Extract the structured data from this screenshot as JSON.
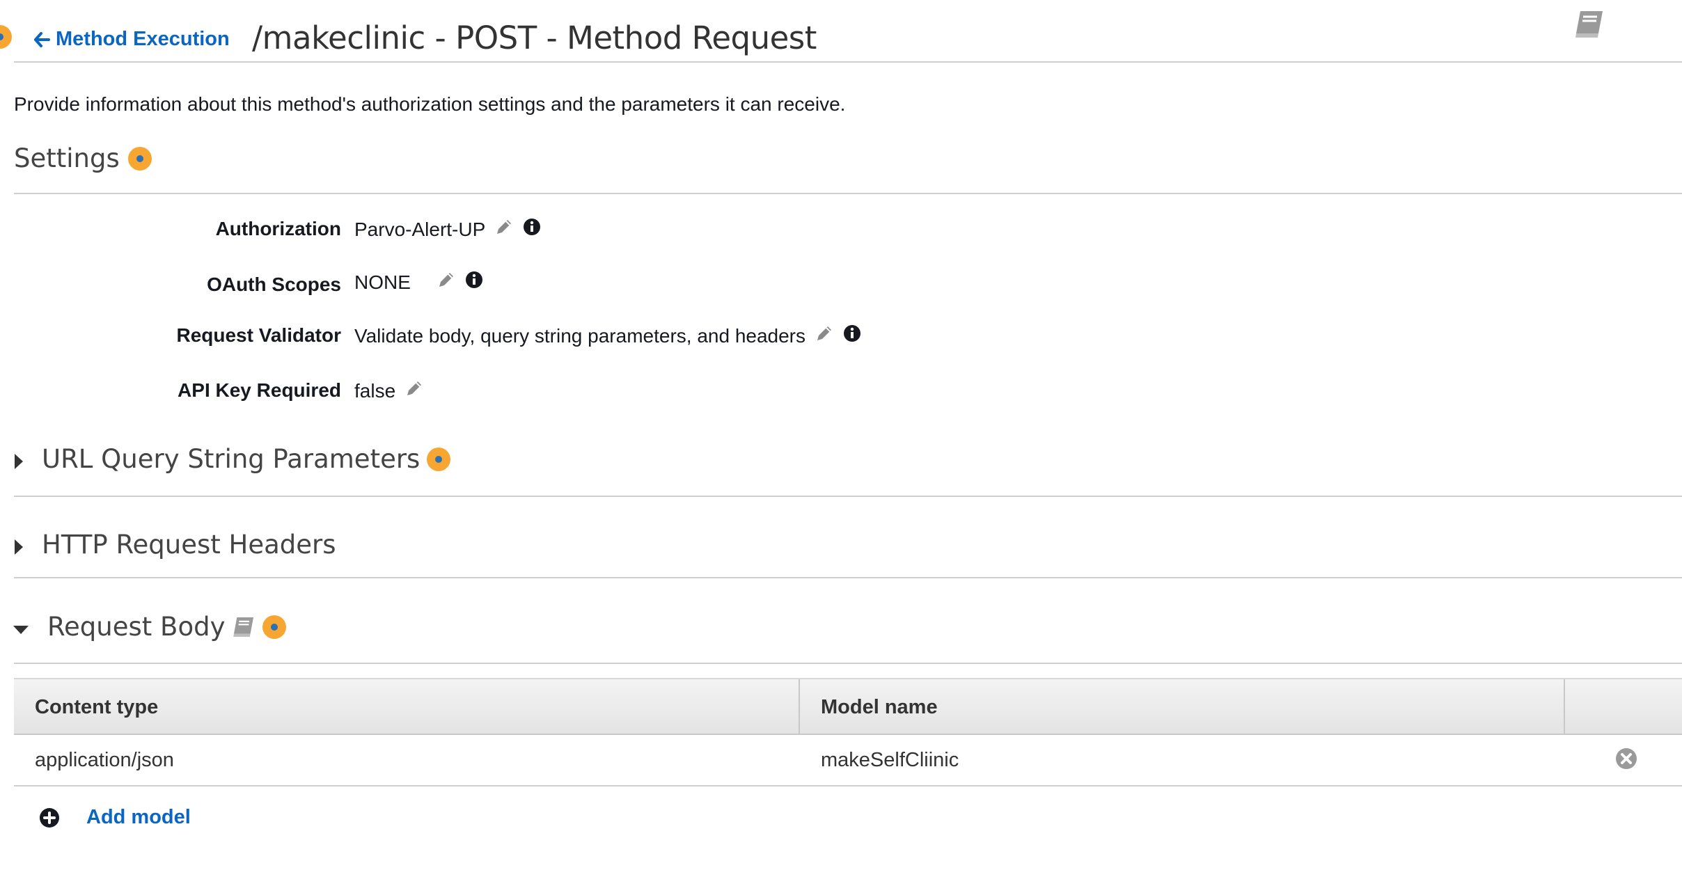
{
  "header": {
    "back_label": "Method Execution",
    "title": "/makeclinic - POST - Method Request"
  },
  "description": "Provide information about this method's authorization settings and the parameters it can receive.",
  "settings": {
    "title": "Settings",
    "rows": [
      {
        "label": "Authorization",
        "value": "Parvo-Alert-UP"
      },
      {
        "label": "OAuth Scopes",
        "value": "NONE"
      },
      {
        "label": "Request Validator",
        "value": "Validate body, query string parameters, and headers"
      },
      {
        "label": "API Key Required",
        "value": "false"
      }
    ]
  },
  "sections": {
    "query_params": "URL Query String Parameters",
    "headers": "HTTP Request Headers",
    "request_body": "Request Body"
  },
  "table": {
    "columns": [
      "Content type",
      "Model name"
    ],
    "rows": [
      {
        "content_type": "application/json",
        "model_name": "makeSelfCliinic"
      }
    ]
  },
  "add_model_label": "Add model",
  "icons": {
    "help": "help-circle-icon",
    "edit": "pencil-icon",
    "info": "info-icon",
    "docs": "book-icon",
    "remove": "remove-circle-icon",
    "add": "plus-circle-icon"
  },
  "colors": {
    "link": "#0b66c2",
    "help_dot": "#f7a631",
    "help_dot_center": "#2a6fb7"
  }
}
